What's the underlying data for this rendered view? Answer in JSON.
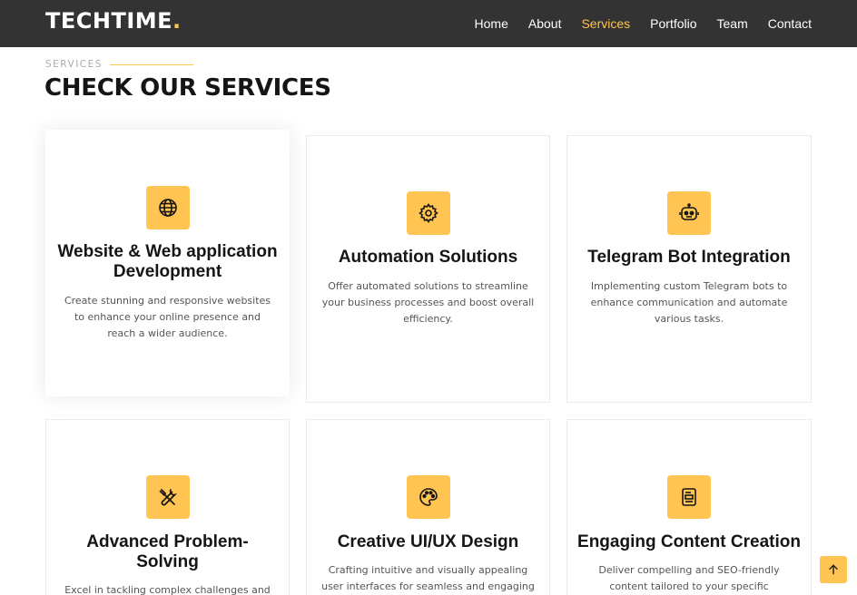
{
  "header": {
    "logo_text": "TECHTIME",
    "logo_dot": ".",
    "nav": [
      {
        "label": "Home",
        "active": false
      },
      {
        "label": "About",
        "active": false
      },
      {
        "label": "Services",
        "active": true
      },
      {
        "label": "Portfolio",
        "active": false
      },
      {
        "label": "Team",
        "active": false
      },
      {
        "label": "Contact",
        "active": false
      }
    ]
  },
  "section": {
    "label": "SERVICES",
    "title": "CHECK OUR SERVICES"
  },
  "services": [
    {
      "icon": "globe-icon",
      "title": "Website & Web application Development",
      "description": "Create stunning and responsive websites to enhance your online presence and reach a wider audience."
    },
    {
      "icon": "gear-icon",
      "title": "Automation Solutions",
      "description": "Offer automated solutions to streamline your business processes and boost overall efficiency."
    },
    {
      "icon": "robot-icon",
      "title": "Telegram Bot Integration",
      "description": "Implementing custom Telegram bots to enhance communication and automate various tasks."
    },
    {
      "icon": "tools-icon",
      "title": "Advanced Problem-Solving",
      "description": "Excel in tackling complex challenges and"
    },
    {
      "icon": "palette-icon",
      "title": "Creative UI/UX Design",
      "description": "Crafting intuitive and visually appealing user interfaces for seamless and engaging user"
    },
    {
      "icon": "document-icon",
      "title": "Engaging Content Creation",
      "description": "Deliver compelling and SEO-friendly content tailored to your specific requirements."
    }
  ],
  "colors": {
    "accent": "#ffc451",
    "header_bg": "#333333",
    "title": "#151515"
  },
  "back_to_top": {
    "icon": "arrow-up-icon"
  }
}
